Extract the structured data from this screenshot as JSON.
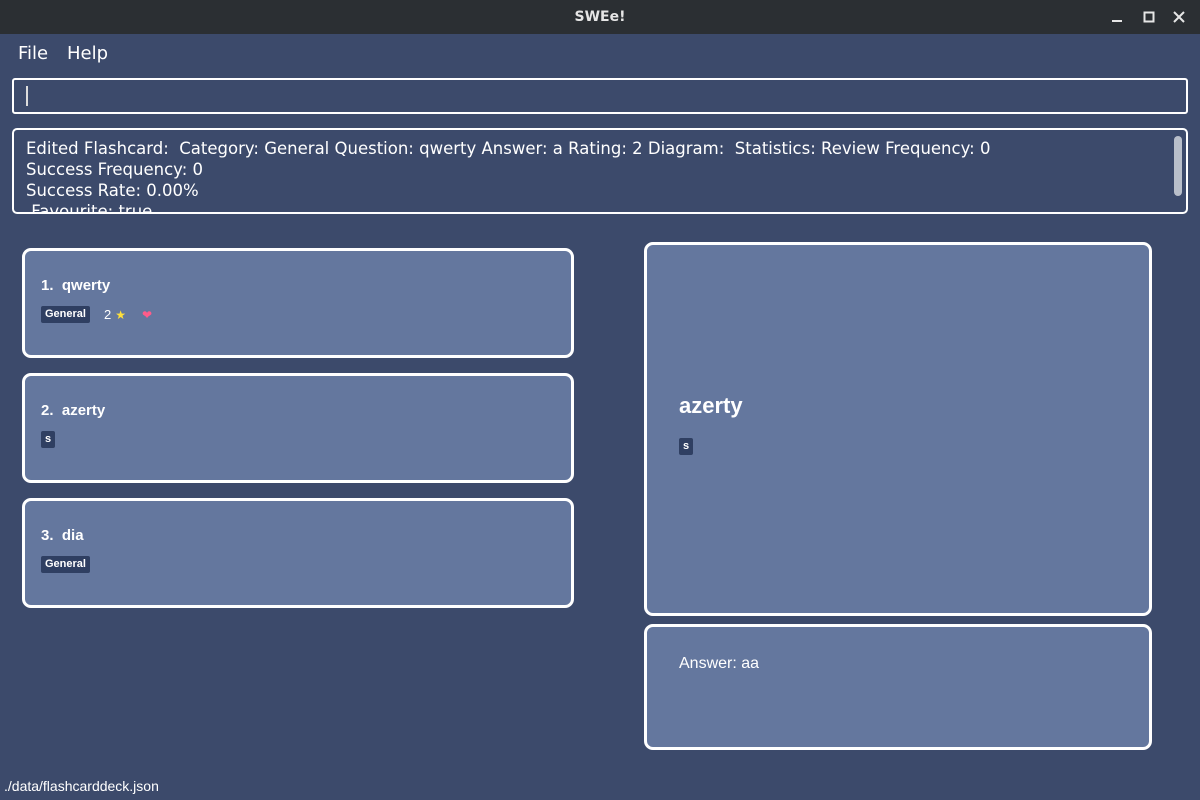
{
  "window": {
    "title": "SWEe!",
    "controls": [
      "minimize-icon",
      "maximize-icon",
      "close-icon"
    ]
  },
  "menu": {
    "file": "File",
    "help": "Help"
  },
  "command_box": {
    "value": "",
    "placeholder": ""
  },
  "result_display": {
    "lines": [
      "Edited Flashcard:  Category: General Question: qwerty Answer: a Rating: 2 Diagram:  Statistics: Review Frequency: 0",
      "Success Frequency: 0",
      "Success Rate: 0.00%",
      " Favourite: true"
    ]
  },
  "flashcards": [
    {
      "index": "1.",
      "question": "qwerty",
      "tag": "General",
      "rating": "2",
      "favourite": true
    },
    {
      "index": "2.",
      "question": "azerty",
      "tag": "s"
    },
    {
      "index": "3.",
      "question": "dia",
      "tag": "General"
    }
  ],
  "selected_card": {
    "question": "azerty",
    "tag": "s",
    "answer": "Answer: aa"
  },
  "status_bar": {
    "path": "./data/flashcarddeck.json"
  },
  "colors": {
    "background": "#3c4a6b",
    "card": "#64779e",
    "tag": "#2f3f62",
    "star": "#ffe03a",
    "heart": "#ff5c8a",
    "titlebar": "#2b2f33"
  }
}
